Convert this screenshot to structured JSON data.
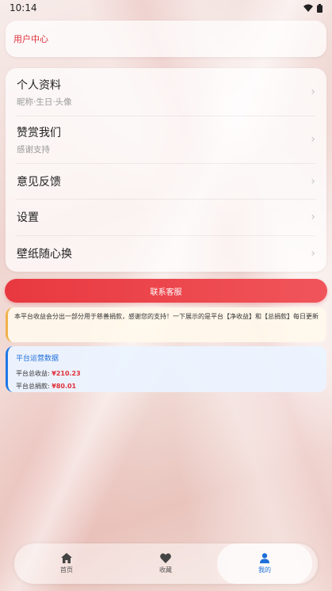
{
  "status_bar": {
    "time": "10:14",
    "icons": [
      "wifi-icon",
      "battery-icon"
    ]
  },
  "user_center": {
    "label": "用户中心"
  },
  "menu": {
    "items": [
      {
        "title": "个人资料",
        "subtitle": "昵称·生日·头像"
      },
      {
        "title": "赞赏我们",
        "subtitle": "感谢支持"
      },
      {
        "title": "意见反馈"
      },
      {
        "title": "设置"
      },
      {
        "title": "壁纸随心换"
      }
    ],
    "chevron": "›"
  },
  "contact_button": {
    "label": "联系客服"
  },
  "notice": {
    "text": "本平台收益会分出一部分用于慈善捐款，感谢您的支持！一下展示的是平台【净收益】和【总捐款】每日更新"
  },
  "stats": {
    "title": "平台运营数据",
    "income_label": "平台总收益:",
    "income_value": "¥210.23",
    "donation_label": "平台总捐款:",
    "donation_value": "¥80.01"
  },
  "tabbar": {
    "tabs": [
      {
        "label": "首页",
        "icon": "home-icon"
      },
      {
        "label": "收藏",
        "icon": "heart-icon"
      },
      {
        "label": "我的",
        "icon": "user-icon"
      }
    ],
    "active": "我的"
  },
  "colors": {
    "accent_red": "#e0303a",
    "accent_blue": "#1e6fd9",
    "notice_border": "#f0b24a"
  }
}
